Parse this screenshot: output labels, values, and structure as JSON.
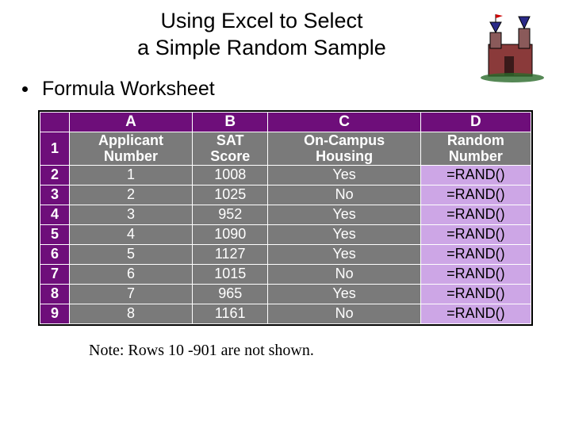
{
  "title_line1": "Using Excel to Select",
  "title_line2": "a Simple Random Sample",
  "bullet": "Formula Worksheet",
  "cols": {
    "a": "A",
    "b": "B",
    "c": "C",
    "d": "D"
  },
  "headers": {
    "a1": "Applicant",
    "a2": "Number",
    "b1": "SAT",
    "b2": "Score",
    "c1": "On-Campus",
    "c2": "Housing",
    "d1": "Random",
    "d2": "Number"
  },
  "rownums": {
    "r1": "1",
    "r2": "2",
    "r3": "3",
    "r4": "4",
    "r5": "5",
    "r6": "6",
    "r7": "7",
    "r8": "8",
    "r9": "9"
  },
  "rows": [
    {
      "app": "1",
      "sat": "1008",
      "hous": "Yes",
      "rand": "=RAND()"
    },
    {
      "app": "2",
      "sat": "1025",
      "hous": "No",
      "rand": "=RAND()"
    },
    {
      "app": "3",
      "sat": "952",
      "hous": "Yes",
      "rand": "=RAND()"
    },
    {
      "app": "4",
      "sat": "1090",
      "hous": "Yes",
      "rand": "=RAND()"
    },
    {
      "app": "5",
      "sat": "1127",
      "hous": "Yes",
      "rand": "=RAND()"
    },
    {
      "app": "6",
      "sat": "1015",
      "hous": "No",
      "rand": "=RAND()"
    },
    {
      "app": "7",
      "sat": "965",
      "hous": "Yes",
      "rand": "=RAND()"
    },
    {
      "app": "8",
      "sat": "1161",
      "hous": "No",
      "rand": "=RAND()"
    }
  ],
  "note": "Note:  Rows 10 -901 are not shown."
}
